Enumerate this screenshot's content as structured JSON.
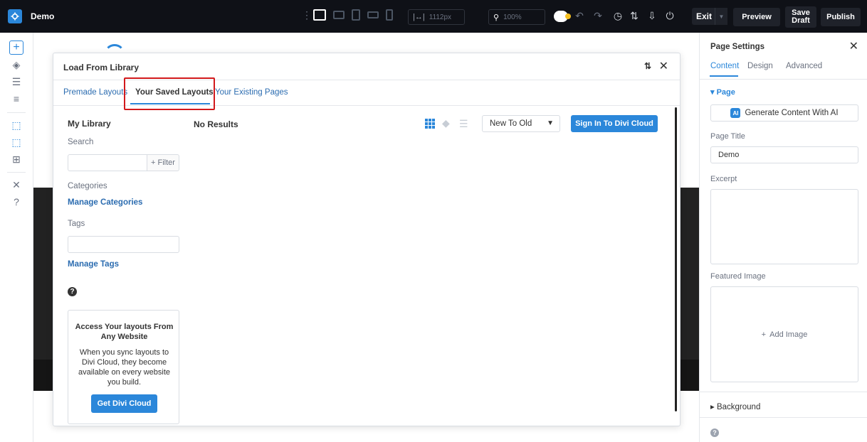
{
  "topbar": {
    "title": "Demo",
    "width_value": "1112px",
    "zoom_value": "100%",
    "exit_label": "Exit",
    "preview_label": "Preview",
    "save_draft_line1": "Save",
    "save_draft_line2": "Draft",
    "publish_label": "Publish"
  },
  "modal": {
    "title": "Load From Library",
    "tabs": [
      {
        "label": "Premade Layouts"
      },
      {
        "label": "Your Saved Layouts"
      },
      {
        "label": "Your Existing Pages"
      }
    ],
    "active_tab": "Your Saved Layouts",
    "library": {
      "title": "My Library",
      "search_label": "Search",
      "filter_label": "+ Filter",
      "categories_label": "Categories",
      "manage_categories": "Manage Categories",
      "tags_label": "Tags",
      "manage_tags": "Manage Tags",
      "help_glyph": "?"
    },
    "promo": {
      "title": "Access Your layouts From Any Website",
      "body": "When you sync layouts to Divi Cloud, they become available on every website you build.",
      "button": "Get Divi Cloud"
    },
    "results": {
      "empty_text": "No Results",
      "sort_value": "New To Old",
      "cloud_button": "Sign In To Divi Cloud"
    }
  },
  "settings": {
    "title": "Page Settings",
    "tabs": [
      {
        "label": "Content"
      },
      {
        "label": "Design"
      },
      {
        "label": "Advanced"
      }
    ],
    "active_tab": "Content",
    "section_label": "Page",
    "ai_badge": "AI",
    "ai_button": "Generate Content With AI",
    "page_title_label": "Page Title",
    "page_title_value": "Demo",
    "excerpt_label": "Excerpt",
    "featured_image_label": "Featured Image",
    "add_image_label": "Add Image",
    "background_label": "Background",
    "help_glyph": "?"
  },
  "colors": {
    "accent": "#2b87da",
    "topbar_bg": "#0f1117",
    "highlight": "#d2191c"
  },
  "icons": [
    "gear-icon",
    "desktop-icon",
    "tablet-icon",
    "phone-icon",
    "width-icon",
    "zoom-icon",
    "undo-icon",
    "redo-icon",
    "history-icon",
    "sort-icon",
    "portability-icon",
    "power-icon",
    "plus-icon",
    "layers-icon",
    "database-icon",
    "wireframe-icon",
    "select-icon",
    "grid-view-icon",
    "tag-icon",
    "list-view-icon",
    "close-icon",
    "help-icon"
  ]
}
